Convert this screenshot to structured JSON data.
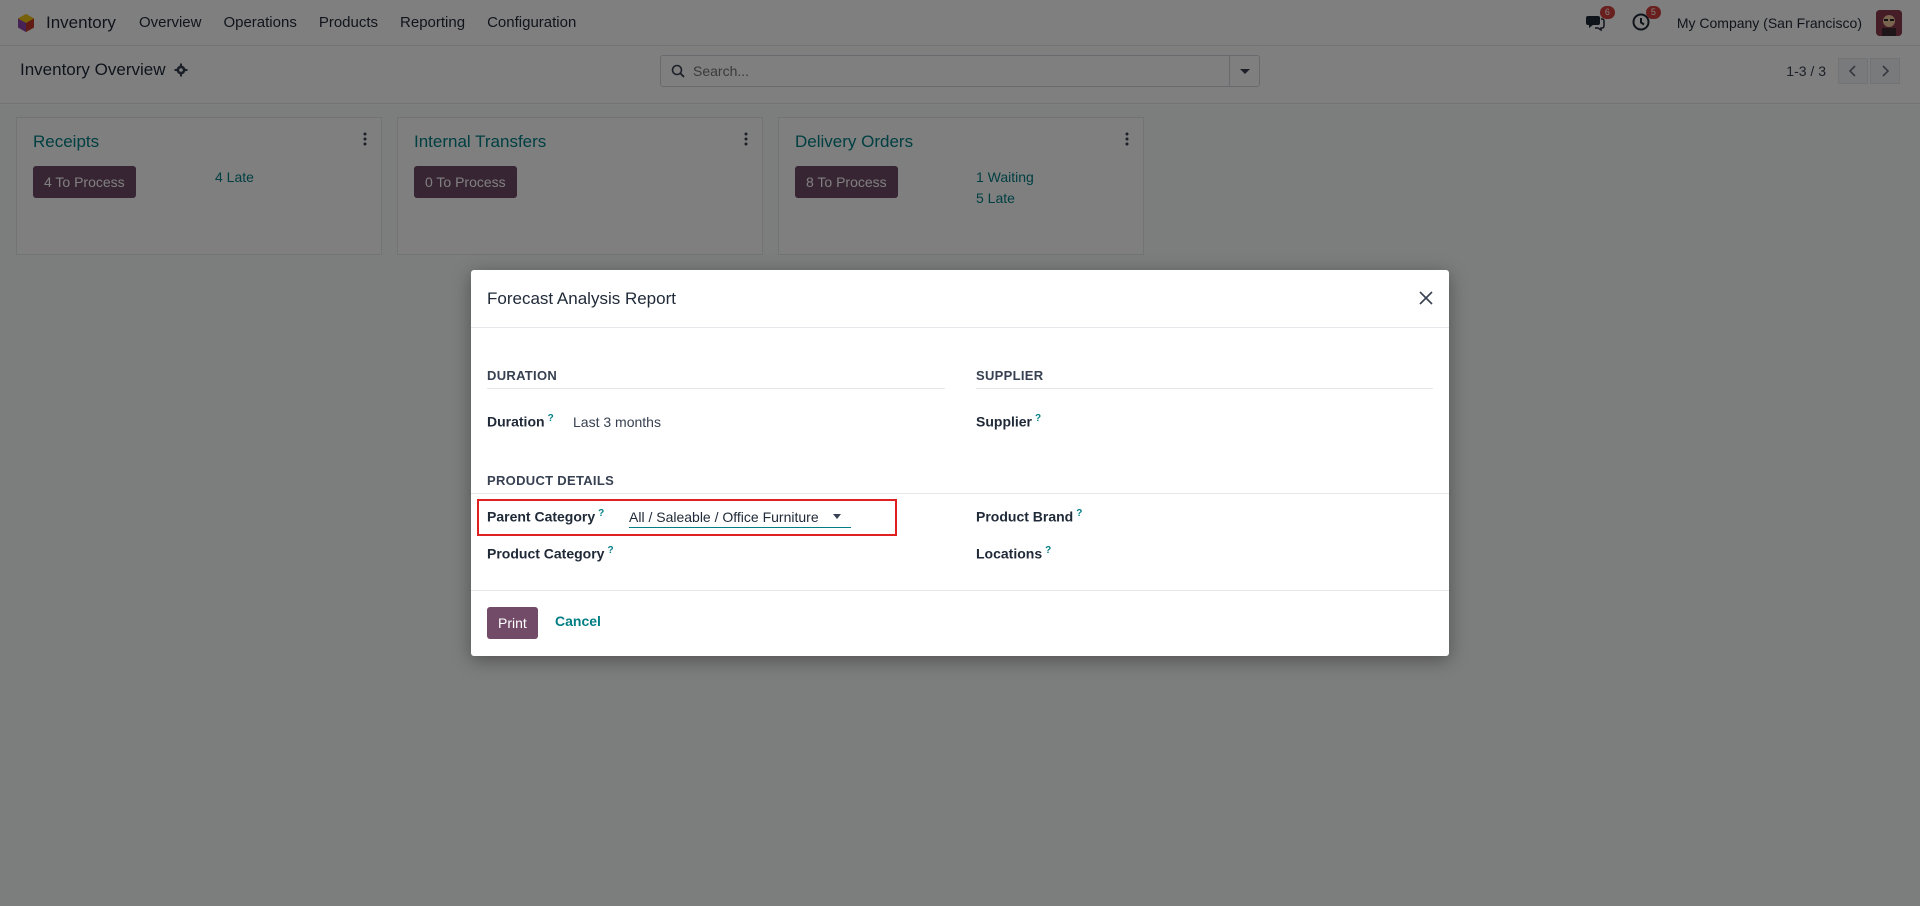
{
  "navbar": {
    "brand": "Inventory",
    "menu": [
      {
        "label": "Overview"
      },
      {
        "label": "Operations"
      },
      {
        "label": "Products"
      },
      {
        "label": "Reporting"
      },
      {
        "label": "Configuration"
      }
    ],
    "messages_badge": "6",
    "activities_badge": "5",
    "company": "My Company (San Francisco)"
  },
  "control_panel": {
    "title": "Inventory Overview",
    "search_placeholder": "Search...",
    "pager": "1-3 / 3"
  },
  "cards": [
    {
      "title": "Receipts",
      "button": "4 To Process",
      "stats": [
        "4 Late"
      ]
    },
    {
      "title": "Internal Transfers",
      "button": "0 To Process",
      "stats": []
    },
    {
      "title": "Delivery Orders",
      "button": "8 To Process",
      "stats": [
        "1 Waiting",
        "5 Late"
      ]
    }
  ],
  "modal": {
    "title": "Forecast Analysis Report",
    "sections": {
      "duration": "DURATION",
      "supplier": "SUPPLIER",
      "product_details": "PRODUCT DETAILS"
    },
    "fields": {
      "duration_label": "Duration",
      "duration_value": "Last 3 months",
      "supplier_label": "Supplier",
      "parent_category_label": "Parent Category",
      "parent_category_value": "All / Saleable / Office Furniture",
      "product_brand_label": "Product Brand",
      "product_category_label": "Product Category",
      "locations_label": "Locations",
      "help_mark": "?"
    },
    "buttons": {
      "print": "Print",
      "cancel": "Cancel"
    }
  },
  "colors": {
    "primary": "#714b67",
    "link": "#017e84",
    "highlight": "#e02020",
    "badge": "#d23f3a"
  }
}
